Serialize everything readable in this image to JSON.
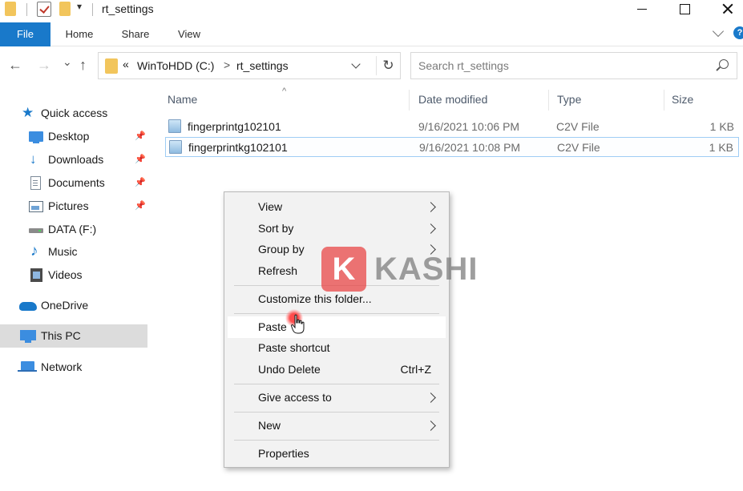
{
  "window": {
    "title": "rt_settings",
    "quick_access_dropdown": "▾"
  },
  "ribbon": {
    "tabs": [
      {
        "label": "File"
      },
      {
        "label": "Home"
      },
      {
        "label": "Share"
      },
      {
        "label": "View"
      }
    ],
    "help_label": "?"
  },
  "navigation": {
    "back_icon": "←",
    "forward_icon": "→",
    "recent_icon": "⌄",
    "up_icon": "↑",
    "address_overflow": "«",
    "address_segments": [
      "WinToHDD (C:)",
      "rt_settings"
    ],
    "address_separator": ">",
    "refresh_icon": "↻",
    "search_placeholder": "Search rt_settings"
  },
  "sidebar": {
    "items": [
      {
        "label": "Quick access",
        "icon": "star-icon"
      },
      {
        "label": "Desktop",
        "icon": "desktop-icon",
        "pinned": true
      },
      {
        "label": "Downloads",
        "icon": "download-icon",
        "pinned": true
      },
      {
        "label": "Documents",
        "icon": "documents-icon",
        "pinned": true
      },
      {
        "label": "Pictures",
        "icon": "pictures-icon",
        "pinned": true
      },
      {
        "label": "DATA (F:)",
        "icon": "drive-icon"
      },
      {
        "label": "Music",
        "icon": "music-icon"
      },
      {
        "label": "Videos",
        "icon": "videos-icon"
      },
      {
        "label": "OneDrive",
        "icon": "onedrive-icon"
      },
      {
        "label": "This PC",
        "icon": "pc-icon",
        "selected": true
      },
      {
        "label": "Network",
        "icon": "network-icon"
      }
    ],
    "pin_glyph": "📌"
  },
  "file_list": {
    "columns": [
      "Name",
      "Date modified",
      "Type",
      "Size"
    ],
    "sort_indicator": "^",
    "rows": [
      {
        "name": "fingerprintg102101",
        "date": "9/16/2021 10:06 PM",
        "type": "C2V File",
        "size": "1 KB"
      },
      {
        "name": "fingerprintkg102101",
        "date": "9/16/2021 10:08 PM",
        "type": "C2V File",
        "size": "1 KB",
        "selected": true
      }
    ]
  },
  "context_menu": {
    "items": [
      {
        "label": "View",
        "submenu": true
      },
      {
        "label": "Sort by",
        "submenu": true
      },
      {
        "label": "Group by",
        "submenu": true
      },
      {
        "label": "Refresh"
      },
      {
        "label": "Customize this folder..."
      },
      {
        "label": "Paste",
        "hover": true
      },
      {
        "label": "Paste shortcut"
      },
      {
        "label": "Undo Delete",
        "shortcut": "Ctrl+Z"
      },
      {
        "label": "Give access to",
        "submenu": true
      },
      {
        "label": "New",
        "submenu": true
      },
      {
        "label": "Properties"
      }
    ]
  },
  "watermark": {
    "logo_letter": "K",
    "brand": "KASHI"
  },
  "colors": {
    "accent": "#1979ca",
    "folder": "#f2c55c",
    "selection_border": "#9fcdf5",
    "menu_background": "#f2f2f2"
  }
}
